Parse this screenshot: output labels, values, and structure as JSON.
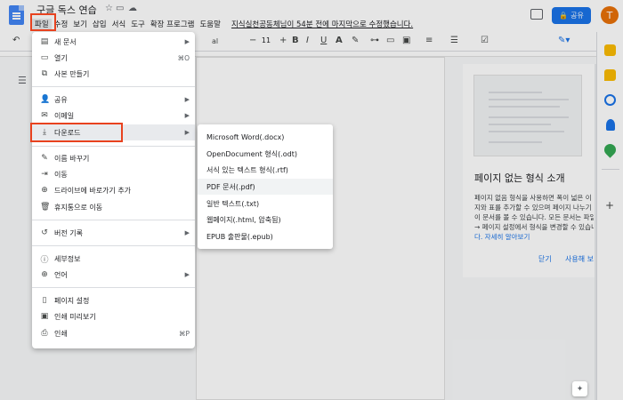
{
  "header": {
    "doc_title": "구글 독스 연습",
    "last_edit": "지식실천공동체님이 54분 전에 마지막으로 수정했습니다.",
    "share_label": "공유",
    "avatar_letter": "T",
    "brand_color": "#1a73e8"
  },
  "menubar": {
    "items": [
      "파일",
      "수정",
      "보기",
      "삽입",
      "서식",
      "도구",
      "확장 프로그램",
      "도움말"
    ]
  },
  "toolbar": {
    "font_size": "11",
    "font_name_fragment": "al"
  },
  "file_menu": {
    "items": [
      {
        "icon": "document-icon",
        "glyph": "▤",
        "label": "새 문서",
        "shortcut": "",
        "submenu": true
      },
      {
        "icon": "folder-icon",
        "glyph": "▭",
        "label": "열기",
        "shortcut": "⌘O",
        "submenu": false
      },
      {
        "icon": "copy-icon",
        "glyph": "⧉",
        "label": "사본 만들기",
        "shortcut": "",
        "submenu": false
      },
      {
        "icon": "person-add-icon",
        "glyph": "👤",
        "label": "공유",
        "shortcut": "",
        "submenu": true
      },
      {
        "icon": "email-icon",
        "glyph": "✉",
        "label": "이메일",
        "shortcut": "",
        "submenu": true
      },
      {
        "icon": "download-icon",
        "glyph": "⤓",
        "label": "다운로드",
        "shortcut": "",
        "submenu": true
      },
      {
        "icon": "rename-icon",
        "glyph": "✎",
        "label": "이름 바꾸기",
        "shortcut": "",
        "submenu": false
      },
      {
        "icon": "move-folder-icon",
        "glyph": "⇥",
        "label": "이동",
        "shortcut": "",
        "submenu": false
      },
      {
        "icon": "drive-shortcut-icon",
        "glyph": "⊕",
        "label": "드라이브에 바로가기 추가",
        "shortcut": "",
        "submenu": false
      },
      {
        "icon": "trash-icon",
        "glyph": "🗑",
        "label": "휴지통으로 이동",
        "shortcut": "",
        "submenu": false
      },
      {
        "icon": "history-icon",
        "glyph": "↺",
        "label": "버전 기록",
        "shortcut": "",
        "submenu": true
      },
      {
        "icon": "info-icon",
        "glyph": "ⓘ",
        "label": "세부정보",
        "shortcut": "",
        "submenu": false
      },
      {
        "icon": "globe-icon",
        "glyph": "⊕",
        "label": "언어",
        "shortcut": "",
        "submenu": true
      },
      {
        "icon": "page-setup-icon",
        "glyph": "▯",
        "label": "페이지 설정",
        "shortcut": "",
        "submenu": false
      },
      {
        "icon": "print-preview-icon",
        "glyph": "▣",
        "label": "인쇄 미리보기",
        "shortcut": "",
        "submenu": false
      },
      {
        "icon": "print-icon",
        "glyph": "⎙",
        "label": "인쇄",
        "shortcut": "⌘P",
        "submenu": false
      }
    ]
  },
  "download_submenu": {
    "items": [
      "Microsoft Word(.docx)",
      "OpenDocument 형식(.odt)",
      "서식 있는 텍스트 형식(.rtf)",
      "PDF 문서(.pdf)",
      "일반 텍스트(.txt)",
      "웹페이지(.html, 압축됨)",
      "EPUB 출판물(.epub)"
    ]
  },
  "side_panel": {
    "title": "페이지 없는 형식 소개",
    "desc_lines": [
      "페이지 없음 형식을 사용하면 폭이 넓은 이",
      "지와 표를 추가할 수 있으며 페이지 나누기",
      "이 문서를 볼 수 있습니다. 모든 문서는 파일",
      "→ 페이지 설정에서 형식을 변경할 수 있습니",
      "다. 자세히 알아보기"
    ],
    "close_label": "닫기",
    "use_label": "사용해 보"
  },
  "annotation_color": "#e8421f"
}
